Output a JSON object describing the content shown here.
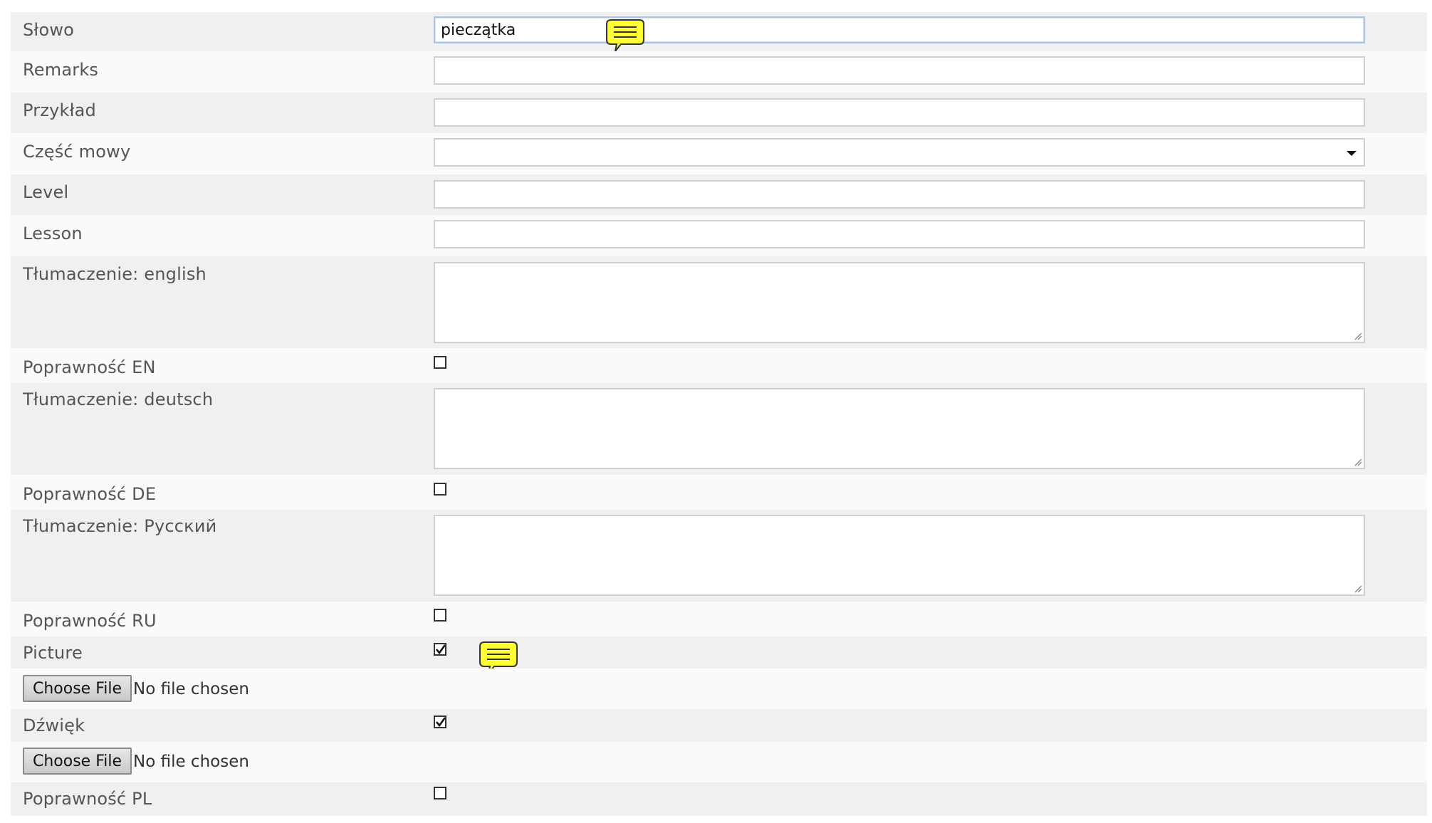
{
  "fields": {
    "slowo": {
      "label": "Słowo",
      "value": "pieczątka"
    },
    "remarks": {
      "label": "Remarks",
      "value": ""
    },
    "przyklad": {
      "label": "Przykład",
      "value": ""
    },
    "czesc_mowy": {
      "label": "Część mowy",
      "value": ""
    },
    "level": {
      "label": "Level",
      "value": ""
    },
    "lesson": {
      "label": "Lesson",
      "value": ""
    },
    "tlum_en": {
      "label": "Tłumaczenie: english",
      "value": ""
    },
    "popr_en": {
      "label": "Poprawność EN",
      "checked": false
    },
    "tlum_de": {
      "label": "Tłumaczenie: deutsch",
      "value": ""
    },
    "popr_de": {
      "label": "Poprawność DE",
      "checked": false
    },
    "tlum_ru": {
      "label": "Tłumaczenie: Русский",
      "value": ""
    },
    "popr_ru": {
      "label": "Poprawność RU",
      "checked": false
    },
    "picture": {
      "label": "Picture",
      "checked": true
    },
    "picture_file": {
      "button": "Choose File",
      "status": "No file chosen"
    },
    "dzwiek": {
      "label": "Dźwięk",
      "checked": true
    },
    "dzwiek_file": {
      "button": "Choose File",
      "status": "No file chosen"
    },
    "popr_pl": {
      "label": "Poprawność PL",
      "checked": false
    }
  },
  "icons": {
    "comment": "speech-bubble-icon"
  },
  "colors": {
    "bubble_fill": "#ffff33",
    "bubble_stroke": "#333333",
    "row_shade": "#f0f0f0",
    "focus_border": "#a9c3e8"
  }
}
